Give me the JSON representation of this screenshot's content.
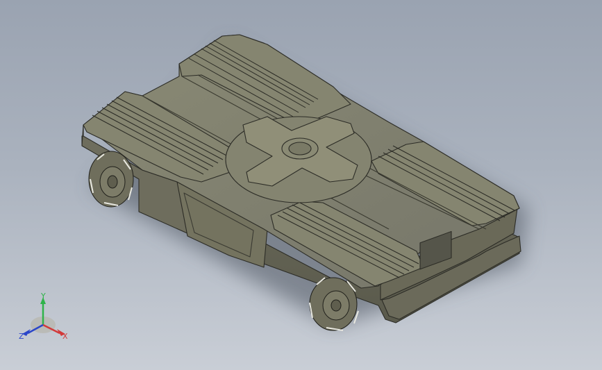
{
  "viewport": {
    "background_top": "#9aa3b1",
    "background_bottom": "#c9ced6",
    "model_color": "#7e7d69"
  },
  "triad": {
    "x_label": "X",
    "y_label": "Y",
    "z_label": "Z",
    "x_color": "#d23a3a",
    "y_color": "#2fb34a",
    "z_color": "#2b46c9"
  }
}
